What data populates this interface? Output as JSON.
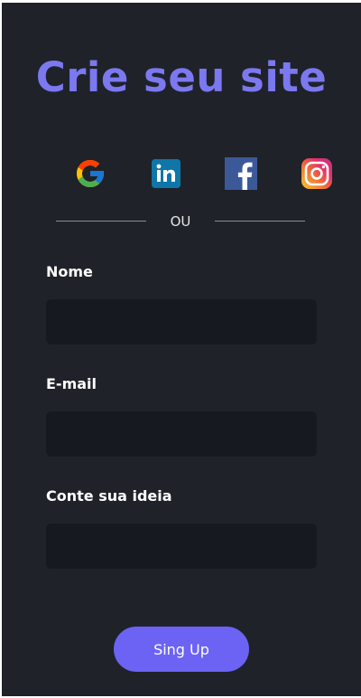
{
  "form": {
    "title": "Crie seu site",
    "divider_text": "OU",
    "fields": [
      {
        "label": "Nome",
        "value": "",
        "placeholder": ""
      },
      {
        "label": "E-mail",
        "value": "",
        "placeholder": ""
      },
      {
        "label": "Conte sua ideia",
        "value": "",
        "placeholder": ""
      }
    ],
    "submit_label": "Sing Up"
  },
  "socials": [
    {
      "icon": "google-icon"
    },
    {
      "icon": "linkedin-icon"
    },
    {
      "icon": "facebook-icon"
    },
    {
      "icon": "instagram-icon"
    }
  ],
  "colors": {
    "background": "#1f2229",
    "accent": "#7b78f0",
    "button": "#6c63f5",
    "input_bg": "#171920",
    "text": "#ffffff"
  }
}
